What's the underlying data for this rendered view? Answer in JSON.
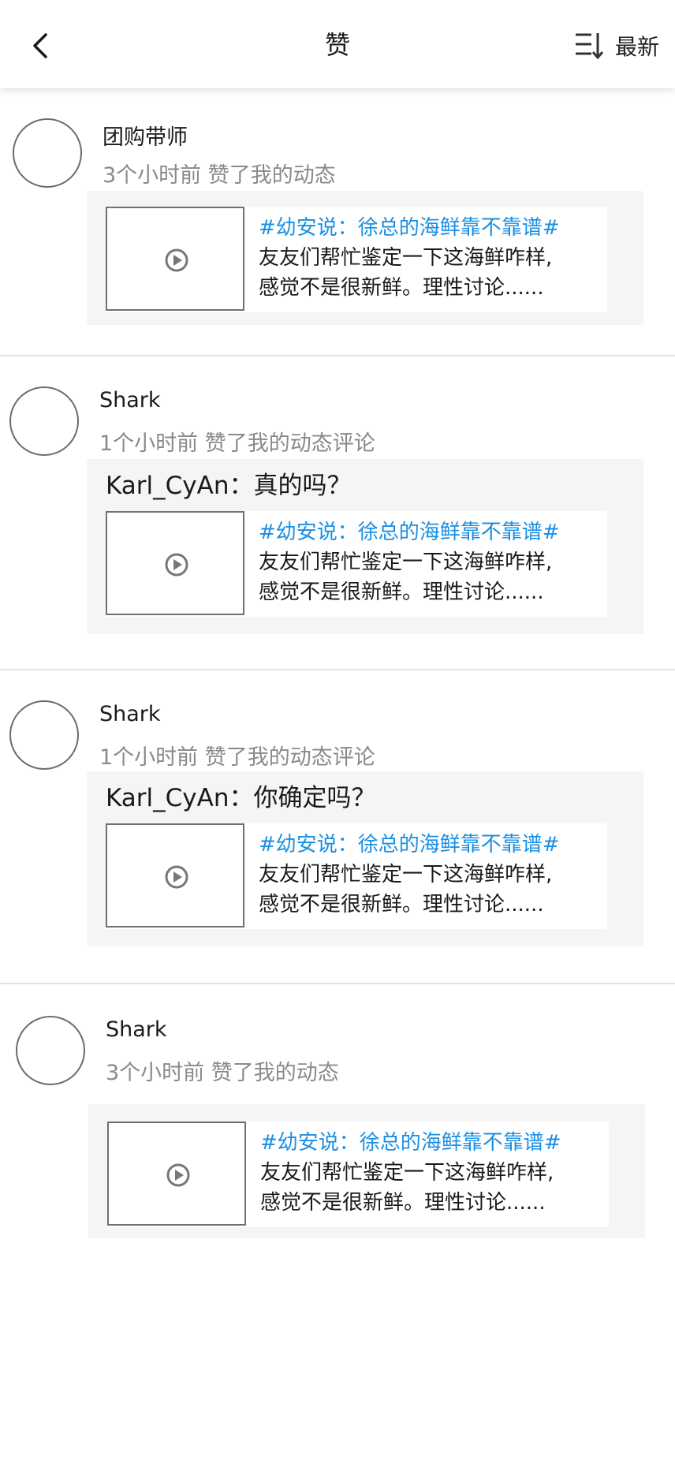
{
  "header": {
    "title": "赞",
    "sort_label": "最新",
    "icons": {
      "back": "back-arrow-icon",
      "sort": "sort-list-icon"
    }
  },
  "post": {
    "topic": "#幼安说：徐总的海鲜靠不靠谱#",
    "line1": "友友们帮忙鉴定一下这海鲜咋样,",
    "line2": "感觉不是很新鲜。理性讨论......"
  },
  "items": [
    {
      "name": "团购带师",
      "meta": "3个小时前 赞了我的动态",
      "comment": ""
    },
    {
      "name": "Shark",
      "meta": "1个小时前 赞了我的动态评论",
      "comment": "Karl_CyAn：真的吗？"
    },
    {
      "name": "Shark",
      "meta": "1个小时前 赞了我的动态评论",
      "comment": "Karl_CyAn：你确定吗？"
    },
    {
      "name": "Shark",
      "meta": "3个小时前 赞了我的动态",
      "comment": ""
    }
  ],
  "colors": {
    "topic": "#1a8fe3",
    "meta": "#8a8a8a",
    "card_bg": "#f5f5f5"
  }
}
